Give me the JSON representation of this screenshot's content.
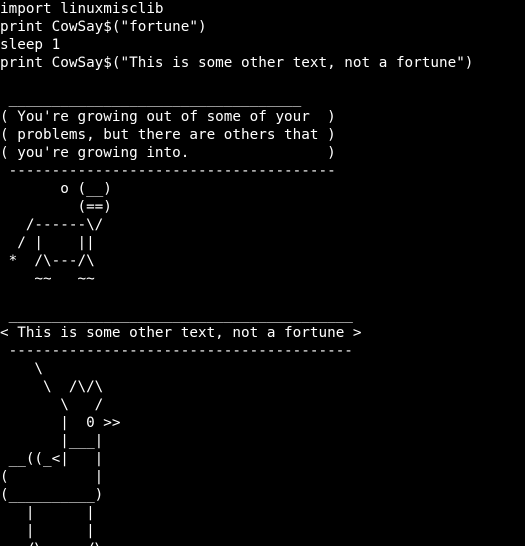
{
  "terminal": {
    "foreground": "#ffffff",
    "background": "#000000",
    "lines": [
      "import linuxmisclib",
      "print CowSay$(\"fortune\")",
      "sleep 1",
      "print CowSay$(\"This is some other text, not a fortune\")",
      "",
      " __________________________________",
      "( You're growing out of some of your  )",
      "( problems, but there are others that )",
      "( you're growing into.                )",
      " --------------------------------------",
      "       o (__)",
      "         (==)",
      "   /------\\/",
      "  / |    ||",
      " *  /\\---/\\",
      "    ~~   ~~",
      "",
      " ________________________________________",
      "< This is some other text, not a fortune >",
      " ----------------------------------------",
      "    \\",
      "     \\  /\\/\\",
      "       \\   /",
      "       |  0 >>",
      "       |___|",
      " __((_<|   |",
      "(          |",
      "(__________)",
      "   |      |",
      "   |      |",
      "   /\\     /\\"
    ]
  }
}
